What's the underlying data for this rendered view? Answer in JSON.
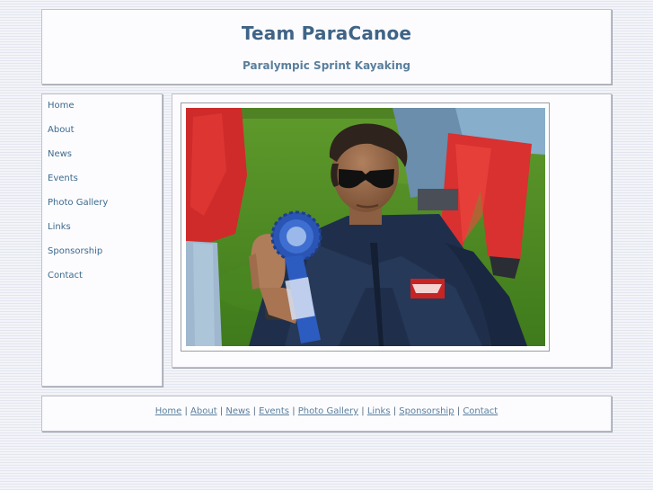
{
  "header": {
    "title": "Team ParaCanoe",
    "subtitle": "Paralympic Sprint Kayaking"
  },
  "sidebar": {
    "items": [
      {
        "label": "Home"
      },
      {
        "label": "About"
      },
      {
        "label": "News"
      },
      {
        "label": "Events"
      },
      {
        "label": "Photo Gallery"
      },
      {
        "label": "Links"
      },
      {
        "label": "Sponsorship"
      },
      {
        "label": "Contact"
      }
    ]
  },
  "footer": {
    "links": [
      {
        "label": "Home"
      },
      {
        "label": "About"
      },
      {
        "label": "News"
      },
      {
        "label": "Events"
      },
      {
        "label": "Photo Gallery"
      },
      {
        "label": "Links"
      },
      {
        "label": "Sponsorship"
      },
      {
        "label": "Contact"
      }
    ],
    "separator": "|"
  },
  "colors": {
    "title": "#3f6486",
    "link": "#3d6a8c",
    "panel": "#fcfcff",
    "page_background": "#eceef6"
  }
}
